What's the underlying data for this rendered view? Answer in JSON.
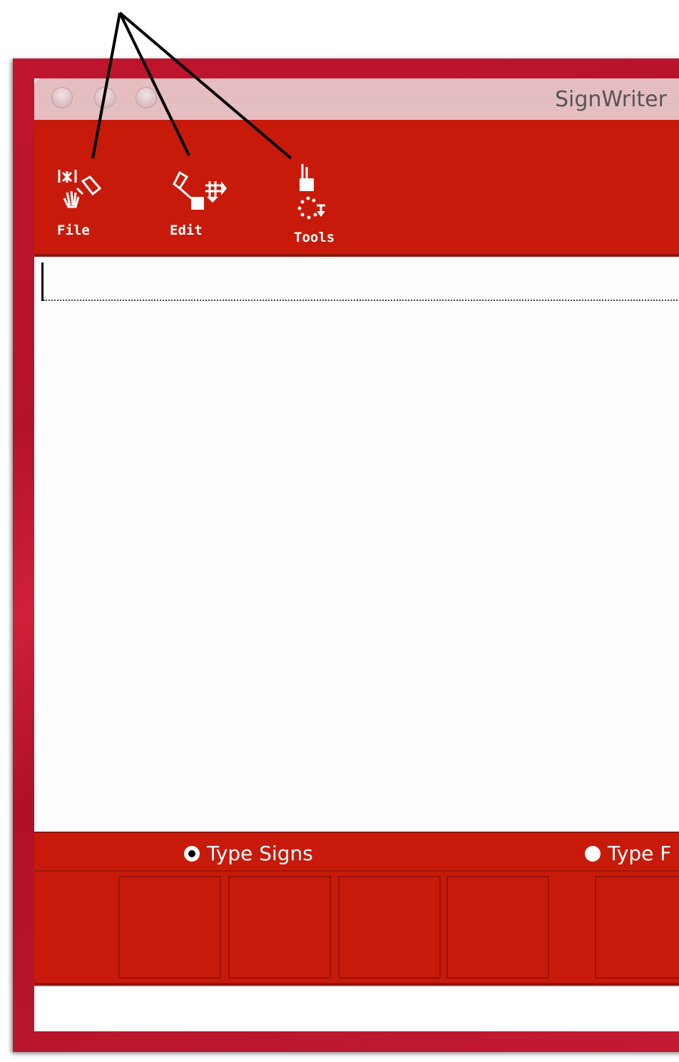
{
  "window": {
    "title": "SignWriter"
  },
  "toolbar": {
    "items": [
      {
        "label": "File",
        "icon": "file-icon"
      },
      {
        "label": "Edit",
        "icon": "edit-icon"
      },
      {
        "label": "Tools",
        "icon": "tools-icon"
      }
    ]
  },
  "input_modes": {
    "options": [
      {
        "label": "Type Signs",
        "selected": true
      },
      {
        "label": "Type F",
        "selected": false
      }
    ]
  },
  "sign_palette": {
    "slot_count": 5
  },
  "colors": {
    "toolbar_red": "#c81a0a",
    "desktop_red": "#c0152e",
    "titlebar_pink": "#eac6c9",
    "document_white": "#fdfdfd"
  }
}
